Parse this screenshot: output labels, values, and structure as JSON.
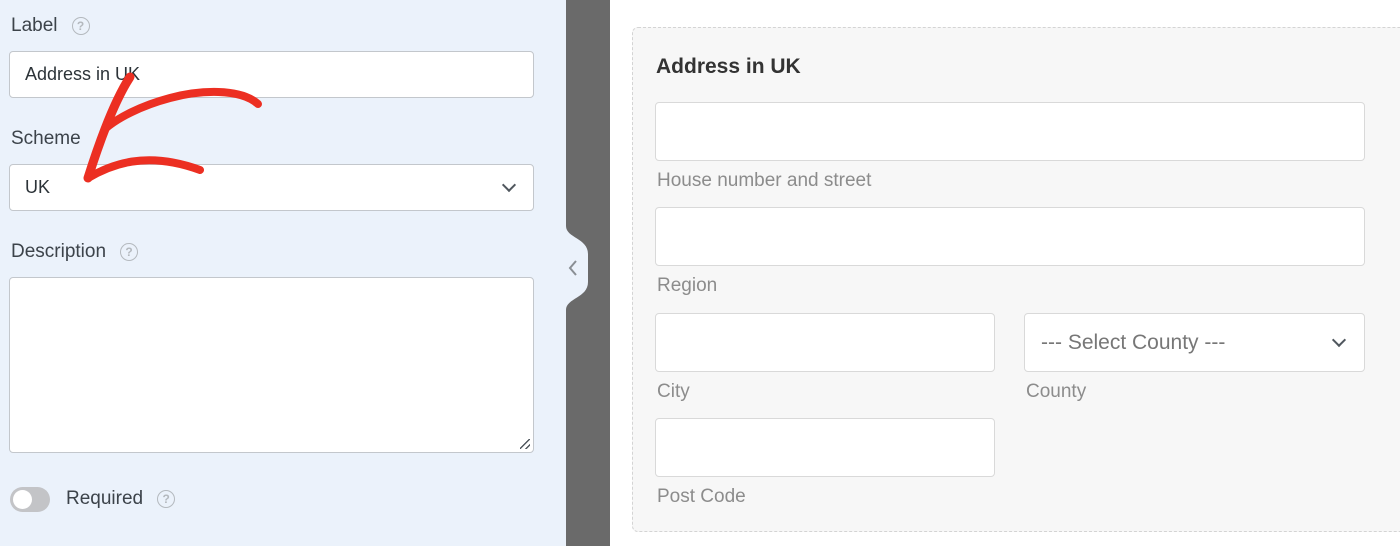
{
  "settings": {
    "label": {
      "title": "Label",
      "value": "Address in UK"
    },
    "scheme": {
      "title": "Scheme",
      "selected": "UK"
    },
    "description": {
      "title": "Description",
      "value": ""
    },
    "required": {
      "title": "Required",
      "enabled": false
    },
    "help_glyph": "?"
  },
  "preview": {
    "title": "Address in UK",
    "fields": {
      "street": {
        "sublabel": "House number and street"
      },
      "region": {
        "sublabel": "Region"
      },
      "city": {
        "sublabel": "City"
      },
      "county": {
        "sublabel": "County",
        "placeholder": "--- Select County ---"
      },
      "postcode": {
        "sublabel": "Post Code"
      }
    }
  },
  "annotation": {
    "arrow_color": "#ec2f22",
    "points_to": "scheme-select"
  },
  "colors": {
    "panel_bg": "#ebf2fb",
    "divider": "#6a6a6a",
    "card_bg": "#f7f7f7"
  }
}
